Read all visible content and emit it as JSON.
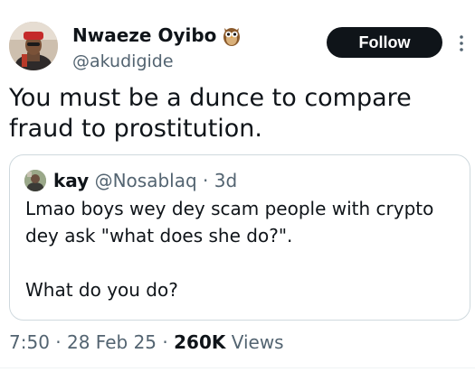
{
  "author": {
    "display_name": "Nwaeze Oyibo",
    "handle": "@akudigide",
    "name_emoji_icon": "owl-emoji"
  },
  "follow_button": {
    "label": "Follow"
  },
  "more_menu_icon": "more-vertical-icon",
  "tweet": {
    "text": "You must be a dunce to compare fraud to prostitution."
  },
  "quote": {
    "name": "kay",
    "handle": "@Nosablaq",
    "separator": "·",
    "time": "3d",
    "text": "Lmao boys wey dey scam people with crypto dey ask \"what does she do?\".\n\nWhat do you do?"
  },
  "meta": {
    "time": "7:50",
    "separator": "·",
    "date": "28 Feb 25",
    "views_count": "260K",
    "views_label": "Views"
  },
  "colors": {
    "text_primary": "#0f1419",
    "text_secondary": "#536471",
    "border": "#cfd9de",
    "follow_bg": "#0f1419"
  }
}
